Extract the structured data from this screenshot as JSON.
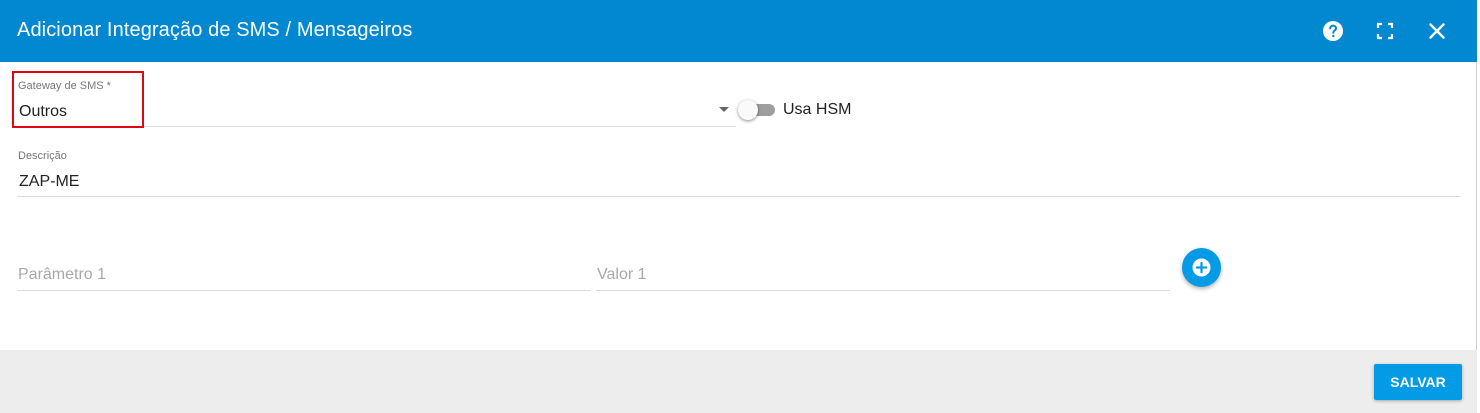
{
  "dialog": {
    "title": "Adicionar Integração de SMS / Mensageiros",
    "header_icons": [
      "help-icon",
      "fullscreen-icon",
      "close-icon"
    ]
  },
  "form": {
    "gateway": {
      "label": "Gateway de SMS *",
      "value": "Outros"
    },
    "hsm_toggle": {
      "label": "Usa HSM",
      "checked": false
    },
    "description": {
      "label": "Descrição",
      "value": "ZAP-ME"
    },
    "param_name": {
      "placeholder": "Parâmetro 1",
      "value": ""
    },
    "param_value": {
      "placeholder": "Valor 1",
      "value": ""
    },
    "add_param_icon": "plus-circle-icon"
  },
  "footer": {
    "save_label": "SALVAR"
  },
  "colors": {
    "header": "#0288d1",
    "primary": "#039be5",
    "highlight": "#e10613",
    "footer_bg": "#ededed"
  }
}
